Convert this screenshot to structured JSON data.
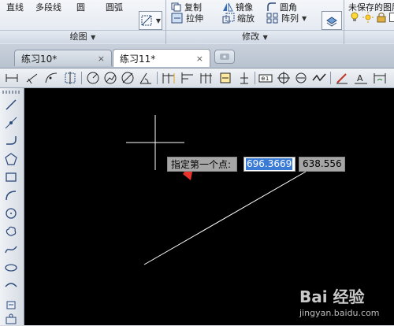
{
  "ribbon": {
    "line_label": "直线",
    "polyline_label": "多段线",
    "circle_label": "圆",
    "arc_label": "圆弧",
    "copy_label": "复制",
    "mirror_label": "镜像",
    "fillet_label": "圆角",
    "stretch_label": "拉伸",
    "scale_label": "缩放",
    "array_label": "阵列",
    "draw_panel_label": "绘图",
    "modify_panel_label": "修改",
    "layers_label": "未保存的图层状态"
  },
  "tabs": [
    {
      "label": "练习10*",
      "close": "×",
      "active": false
    },
    {
      "label": "练习11*",
      "close": "×",
      "active": true
    }
  ],
  "canvas": {
    "prompt_text": "指定第一个点:",
    "coord_x": "696.3669",
    "coord_y": "638.556"
  },
  "watermark": {
    "logo": "Bai 经验",
    "url": "jingyan.baidu.com"
  },
  "colors": {
    "canvas_bg": "#000000",
    "accent_red": "#e8312a",
    "selection_blue": "#3a7bd5"
  }
}
